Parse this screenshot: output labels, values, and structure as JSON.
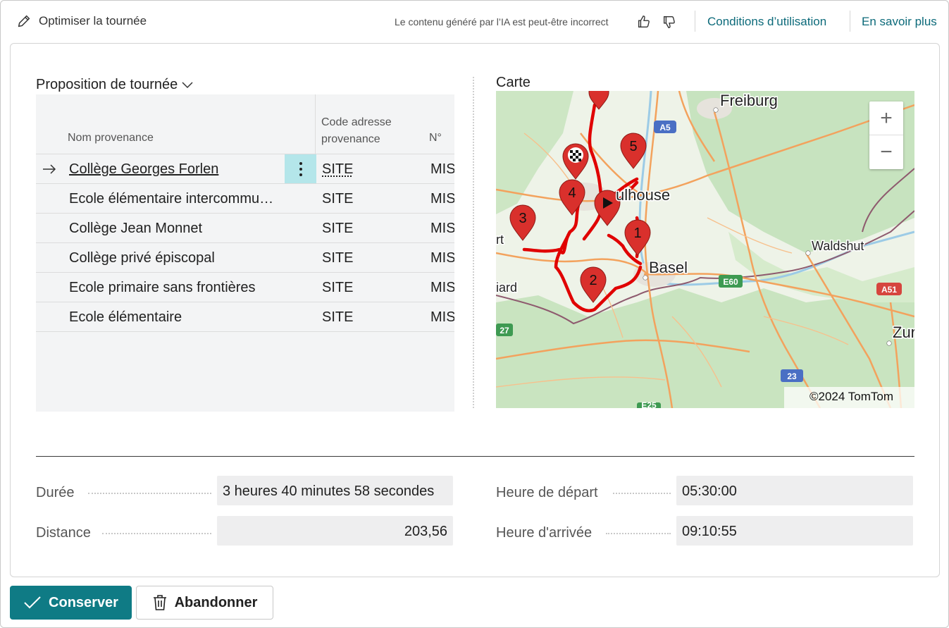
{
  "header": {
    "title": "Optimiser la tournée",
    "disclaimer": "Le contenu généré par l’IA est peut-être incorrect",
    "terms_link": "Conditions d’utilisation",
    "learn_more_link": "En savoir plus"
  },
  "proposal": {
    "title": "Proposition de tournée",
    "columns": [
      "Nom provenance",
      "Code adresse provenance",
      "N°"
    ],
    "rows": [
      {
        "name": "Collège Georges Forlen",
        "code": "SITE",
        "num": "MIS"
      },
      {
        "name": "Ecole élémentaire intercommunale",
        "code": "SITE",
        "num": "MIS"
      },
      {
        "name": "Collège Jean Monnet",
        "code": "SITE",
        "num": "MIS"
      },
      {
        "name": "Collège privé épiscopal",
        "code": "SITE",
        "num": "MIS"
      },
      {
        "name": "Ecole primaire sans frontières",
        "code": "SITE",
        "num": "MIS"
      },
      {
        "name": "Ecole élémentaire",
        "code": "SITE",
        "num": "MIS"
      }
    ]
  },
  "map": {
    "title": "Carte",
    "copyright": "©2024 TomTom",
    "zoom_in": "+",
    "zoom_out": "−",
    "places": {
      "freiburg": "Freiburg",
      "mulhouse": "ulhouse",
      "basel": "Basel",
      "waldshut": "Waldshut",
      "zurich": "Zur",
      "left_cut_1": "rt",
      "left_cut_2": "iard"
    },
    "road_badges": {
      "a5": "A5",
      "e60": "E60",
      "a51": "A51",
      "e27": "27",
      "e23": "23",
      "e25": "E25"
    },
    "markers": [
      "1",
      "2",
      "3",
      "4",
      "5"
    ],
    "route_color": "#e00000",
    "marker_color": "#d9302c"
  },
  "summary": {
    "duration_label": "Durée",
    "duration_value": "3 heures 40 minutes 58 secondes",
    "distance_label": "Distance",
    "distance_value": "203,56",
    "departure_label": "Heure de départ",
    "departure_value": "05:30:00",
    "arrival_label": "Heure d'arrivée",
    "arrival_value": "09:10:55"
  },
  "footer": {
    "keep_label": "Conserver",
    "discard_label": "Abandonner"
  },
  "colors": {
    "accent": "#0f7b85",
    "link": "#0c6a7a",
    "selected_menu": "#b4e6ea"
  }
}
